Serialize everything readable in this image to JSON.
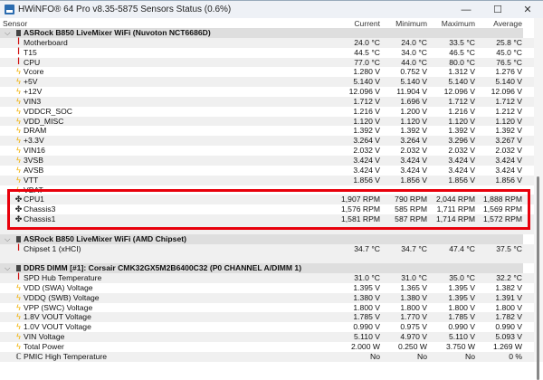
{
  "window": {
    "title": "HWiNFO® 64 Pro v8.35-5875 Sensors Status (0.6%)",
    "minimize": "—",
    "maximize": "☐",
    "close": "✕"
  },
  "columns": {
    "sensor": "Sensor",
    "current": "Current",
    "minimum": "Minimum",
    "maximum": "Maximum",
    "average": "Average"
  },
  "colors": {
    "highlight": "#e8000b",
    "section_bg": "#dedede",
    "thermometer": "#d01010",
    "bolt": "#f0b000"
  },
  "rows": [
    {
      "type": "section",
      "label": "ASRock B850 LiveMixer WiFi (Nuvoton NCT6686D)"
    },
    {
      "icon": "thermometer",
      "label": "Motherboard",
      "values": [
        "24.0 °C",
        "24.0 °C",
        "33.5 °C",
        "25.8 °C"
      ]
    },
    {
      "icon": "thermometer",
      "label": "T15",
      "values": [
        "44.5 °C",
        "34.0 °C",
        "46.5 °C",
        "45.0 °C"
      ]
    },
    {
      "icon": "thermometer",
      "label": "CPU",
      "values": [
        "77.0 °C",
        "44.0 °C",
        "80.0 °C",
        "76.5 °C"
      ]
    },
    {
      "icon": "bolt",
      "label": "Vcore",
      "values": [
        "1.280 V",
        "0.752 V",
        "1.312 V",
        "1.276 V"
      ]
    },
    {
      "icon": "bolt",
      "label": "+5V",
      "values": [
        "5.140 V",
        "5.140 V",
        "5.140 V",
        "5.140 V"
      ]
    },
    {
      "icon": "bolt",
      "label": "+12V",
      "values": [
        "12.096 V",
        "11.904 V",
        "12.096 V",
        "12.096 V"
      ]
    },
    {
      "icon": "bolt",
      "label": "VIN3",
      "values": [
        "1.712 V",
        "1.696 V",
        "1.712 V",
        "1.712 V"
      ]
    },
    {
      "icon": "bolt",
      "label": "VDDCR_SOC",
      "values": [
        "1.216 V",
        "1.200 V",
        "1.216 V",
        "1.212 V"
      ]
    },
    {
      "icon": "bolt",
      "label": "VDD_MISC",
      "values": [
        "1.120 V",
        "1.120 V",
        "1.120 V",
        "1.120 V"
      ]
    },
    {
      "icon": "bolt",
      "label": "DRAM",
      "values": [
        "1.392 V",
        "1.392 V",
        "1.392 V",
        "1.392 V"
      ]
    },
    {
      "icon": "bolt",
      "label": "+3.3V",
      "values": [
        "3.264 V",
        "3.264 V",
        "3.296 V",
        "3.267 V"
      ]
    },
    {
      "icon": "bolt",
      "label": "VIN16",
      "values": [
        "2.032 V",
        "2.032 V",
        "2.032 V",
        "2.032 V"
      ]
    },
    {
      "icon": "bolt",
      "label": "3VSB",
      "values": [
        "3.424 V",
        "3.424 V",
        "3.424 V",
        "3.424 V"
      ]
    },
    {
      "icon": "bolt",
      "label": "AVSB",
      "values": [
        "3.424 V",
        "3.424 V",
        "3.424 V",
        "3.424 V"
      ]
    },
    {
      "icon": "bolt",
      "label": "VTT",
      "values": [
        "1.856 V",
        "1.856 V",
        "1.856 V",
        "1.856 V"
      ]
    },
    {
      "icon": "bolt",
      "label": "VBAT",
      "values": [
        "",
        "",
        "",
        ""
      ]
    },
    {
      "icon": "fan",
      "label": "CPU1",
      "values": [
        "1,907 RPM",
        "790 RPM",
        "2,044 RPM",
        "1,888 RPM"
      ]
    },
    {
      "icon": "fan",
      "label": "Chassis3",
      "values": [
        "1,576 RPM",
        "585 RPM",
        "1,711 RPM",
        "1,569 RPM"
      ]
    },
    {
      "icon": "fan",
      "label": "Chassis1",
      "values": [
        "1,581 RPM",
        "587 RPM",
        "1,714 RPM",
        "1,572 RPM"
      ]
    },
    {
      "type": "blank"
    },
    {
      "type": "section",
      "label": "ASRock B850 LiveMixer WiFi (AMD Chipset)"
    },
    {
      "icon": "thermometer",
      "label": "Chipset 1 (xHCI)",
      "values": [
        "34.7 °C",
        "34.7 °C",
        "47.4 °C",
        "37.5 °C"
      ]
    },
    {
      "type": "blank"
    },
    {
      "type": "section",
      "label": "DDR5 DIMM [#1]: Corsair CMK32GX5M2B6400C32 (P0 CHANNEL A/DIMM 1)"
    },
    {
      "icon": "thermometer",
      "label": "SPD Hub Temperature",
      "values": [
        "31.0 °C",
        "31.0 °C",
        "35.0 °C",
        "32.2 °C"
      ]
    },
    {
      "icon": "bolt",
      "label": "VDD (SWA) Voltage",
      "values": [
        "1.395 V",
        "1.365 V",
        "1.395 V",
        "1.382 V"
      ]
    },
    {
      "icon": "bolt",
      "label": "VDDQ (SWB) Voltage",
      "values": [
        "1.380 V",
        "1.380 V",
        "1.395 V",
        "1.391 V"
      ]
    },
    {
      "icon": "bolt",
      "label": "VPP (SWC) Voltage",
      "values": [
        "1.800 V",
        "1.800 V",
        "1.800 V",
        "1.800 V"
      ]
    },
    {
      "icon": "bolt",
      "label": "1.8V VOUT Voltage",
      "values": [
        "1.785 V",
        "1.770 V",
        "1.785 V",
        "1.782 V"
      ]
    },
    {
      "icon": "bolt",
      "label": "1.0V VOUT Voltage",
      "values": [
        "0.990 V",
        "0.975 V",
        "0.990 V",
        "0.990 V"
      ]
    },
    {
      "icon": "bolt",
      "label": "VIN Voltage",
      "values": [
        "5.110 V",
        "4.970 V",
        "5.110 V",
        "5.093 V"
      ]
    },
    {
      "icon": "bolt",
      "label": "Total Power",
      "values": [
        "2.000 W",
        "0.250 W",
        "3.750 W",
        "1.269 W"
      ]
    },
    {
      "icon": "status",
      "label": "PMIC High Temperature",
      "values": [
        "No",
        "No",
        "No",
        "0 %"
      ]
    }
  ]
}
